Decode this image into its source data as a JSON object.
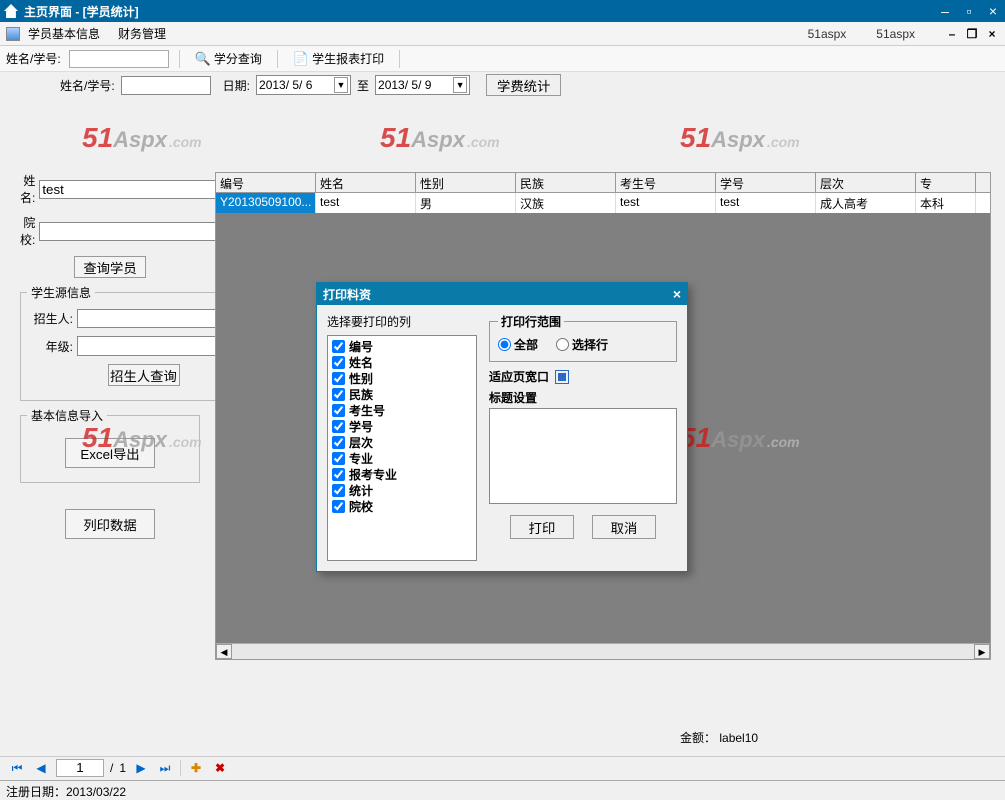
{
  "titlebar": {
    "title": "主页界面 - [学员统计]"
  },
  "menubar": {
    "item1": "学员基本信息",
    "item2": "财务管理",
    "right1": "51aspx",
    "right2": "51aspx"
  },
  "querybar": {
    "label_name": "姓名/学号:",
    "btn_credit": "学分查询",
    "btn_print": "学生报表打印"
  },
  "innerbar": {
    "label_name": "姓名/学号:",
    "label_date": "日期:",
    "date_from": "2013/ 5/ 6",
    "date_to_label": "至",
    "date_to": "2013/ 5/ 9",
    "btn_fee": "学费统计"
  },
  "left": {
    "name_label": "姓名:",
    "name_value": "test",
    "school_label": "院校:",
    "btn_query": "查询学员",
    "group_source": "学生源信息",
    "recruiter_label": "招生人:",
    "grade_label": "年级:",
    "btn_recruiter": "招生人查询",
    "group_export": "基本信息导入",
    "btn_excel": "Excel导出",
    "btn_listprint": "列印数据"
  },
  "grid": {
    "headers": [
      "编号",
      "姓名",
      "性别",
      "民族",
      "考生号",
      "学号",
      "层次",
      "专"
    ],
    "rows": [
      [
        "Y20130509100...",
        "test",
        "男",
        "汉族",
        "test",
        "test",
        "成人高考",
        "本科"
      ]
    ]
  },
  "amount": {
    "label": "金额：",
    "value": "label10"
  },
  "nav": {
    "page": "1",
    "total_sep": "/",
    "total": "1"
  },
  "status": {
    "text": "注册日期：2013/03/22"
  },
  "watermark": {
    "num": "51",
    "text": "Aspx",
    "suffix": ".com"
  },
  "dialog": {
    "title": "打印料资",
    "choose_label": "选择要打印的列",
    "columns": [
      "编号",
      "姓名",
      "性别",
      "民族",
      "考生号",
      "学号",
      "层次",
      "专业",
      "报考专业",
      "统计",
      "院校"
    ],
    "range_legend": "打印行范围",
    "radio_all": "全部",
    "radio_sel": "选择行",
    "fitwidth": "适应页宽口",
    "title_setting": "标题设置",
    "btn_print": "打印",
    "btn_cancel": "取消"
  }
}
